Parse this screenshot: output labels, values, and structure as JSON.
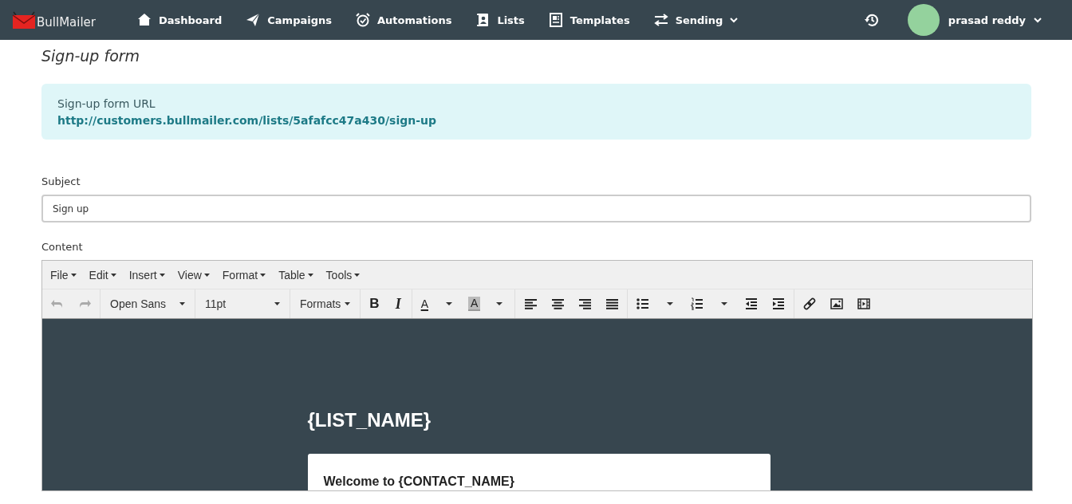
{
  "navbar": {
    "brand": "BullMailer",
    "items": [
      {
        "label": "Dashboard",
        "has_menu": false
      },
      {
        "label": "Campaigns",
        "has_menu": false
      },
      {
        "label": "Automations",
        "has_menu": false
      },
      {
        "label": "Lists",
        "has_menu": false
      },
      {
        "label": "Templates",
        "has_menu": false
      },
      {
        "label": "Sending",
        "has_menu": true
      }
    ],
    "user": {
      "name": "prasad reddy"
    }
  },
  "page_title": "Sign-up form",
  "info_box": {
    "label": "Sign-up form URL",
    "url": "http://customers.bullmailer.com/lists/5afafcc47a430/sign-up"
  },
  "subject": {
    "label": "Subject",
    "value": "Sign up"
  },
  "content": {
    "label": "Content",
    "menubar": [
      "File",
      "Edit",
      "Insert",
      "View",
      "Format",
      "Table",
      "Tools"
    ],
    "toolbar": {
      "font": "Open Sans",
      "size": "11pt",
      "formats": "Formats",
      "undo_disabled": true,
      "redo_disabled": true,
      "bold": "B",
      "italic": "I",
      "text_color": "A",
      "highlight_color": "A"
    },
    "preview": {
      "heading": "{LIST_NAME}",
      "card_heading": "Welcome to {CONTACT_NAME}"
    }
  }
}
